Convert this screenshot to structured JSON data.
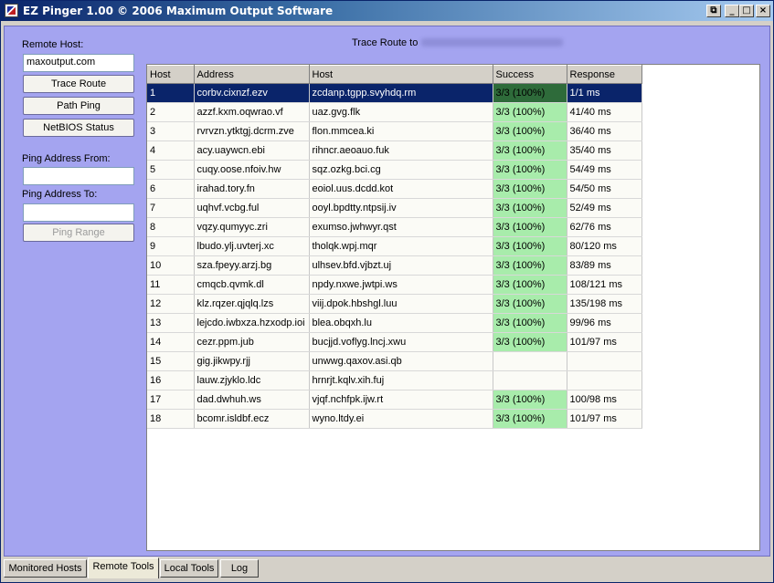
{
  "window": {
    "title": "EZ Pinger 1.00 © 2006 Maximum Output Software",
    "controls": {
      "restore": "⧉",
      "minimize": "_",
      "maximize": "□",
      "close": "×"
    }
  },
  "left_panel": {
    "remote_host_label": "Remote Host:",
    "remote_host_value": "maxoutput.com",
    "trace_route_label": "Trace Route",
    "path_ping_label": "Path Ping",
    "netbios_label": "NetBIOS Status",
    "ping_from_label": "Ping Address From:",
    "ping_from_value": "",
    "ping_to_label": "Ping Address To:",
    "ping_to_value": "",
    "ping_range_label": "Ping Range"
  },
  "trace": {
    "title_prefix": "Trace Route to"
  },
  "table": {
    "columns": [
      "Host",
      "Address",
      "Host",
      "Success",
      "Response"
    ],
    "rows": [
      {
        "hop": "1",
        "address": "corbv.cixnzf.ezv",
        "host": "zcdanp.tgpp.svyhdq.rm",
        "success": "3/3 (100%)",
        "response": "1/1 ms",
        "selected": true
      },
      {
        "hop": "2",
        "address": "azzf.kxm.oqwrao.vf",
        "host": "uaz.gvg.flk",
        "success": "3/3 (100%)",
        "response": "41/40 ms"
      },
      {
        "hop": "3",
        "address": "rvrvzn.ytktgj.dcrm.zve",
        "host": "flon.mmcea.ki",
        "success": "3/3 (100%)",
        "response": "36/40 ms"
      },
      {
        "hop": "4",
        "address": "acy.uaywcn.ebi",
        "host": "rihncr.aeoauo.fuk",
        "success": "3/3 (100%)",
        "response": "35/40 ms"
      },
      {
        "hop": "5",
        "address": "cuqy.oose.nfoiv.hw",
        "host": "sqz.ozkg.bci.cg",
        "success": "3/3 (100%)",
        "response": "54/49 ms"
      },
      {
        "hop": "6",
        "address": "irahad.tory.fn",
        "host": "eoiol.uus.dcdd.kot",
        "success": "3/3 (100%)",
        "response": "54/50 ms"
      },
      {
        "hop": "7",
        "address": "uqhvf.vcbg.ful",
        "host": "ooyl.bpdtty.ntpsij.iv",
        "success": "3/3 (100%)",
        "response": "52/49 ms"
      },
      {
        "hop": "8",
        "address": "vqzy.qumyyc.zri",
        "host": "exumso.jwhwyr.qst",
        "success": "3/3 (100%)",
        "response": "62/76 ms"
      },
      {
        "hop": "9",
        "address": "lbudo.ylj.uvterj.xc",
        "host": "tholqk.wpj.mqr",
        "success": "3/3 (100%)",
        "response": "80/120 ms"
      },
      {
        "hop": "10",
        "address": "sza.fpeyy.arzj.bg",
        "host": "ulhsev.bfd.vjbzt.uj",
        "success": "3/3 (100%)",
        "response": "83/89 ms"
      },
      {
        "hop": "11",
        "address": "cmqcb.qvmk.dl",
        "host": "npdy.nxwe.jwtpi.ws",
        "success": "3/3 (100%)",
        "response": "108/121 ms"
      },
      {
        "hop": "12",
        "address": "klz.rqzer.qjqlq.lzs",
        "host": "viij.dpok.hbshgl.luu",
        "success": "3/3 (100%)",
        "response": "135/198 ms"
      },
      {
        "hop": "13",
        "address": "lejcdo.iwbxza.hzxodp.ioi",
        "host": "blea.obqxh.lu",
        "success": "3/3 (100%)",
        "response": "99/96 ms"
      },
      {
        "hop": "14",
        "address": "cezr.ppm.jub",
        "host": "bucjjd.voflyg.lncj.xwu",
        "success": "3/3 (100%)",
        "response": "101/97 ms"
      },
      {
        "hop": "15",
        "address": "gig.jikwpy.rjj",
        "host": "unwwg.qaxov.asi.qb",
        "success": "",
        "response": ""
      },
      {
        "hop": "16",
        "address": "lauw.zjyklo.ldc",
        "host": "hrnrjt.kqlv.xih.fuj",
        "success": "",
        "response": ""
      },
      {
        "hop": "17",
        "address": "dad.dwhuh.ws",
        "host": "vjqf.nchfpk.ijw.rt",
        "success": "3/3 (100%)",
        "response": "100/98 ms"
      },
      {
        "hop": "18",
        "address": "bcomr.isldbf.ecz",
        "host": "wyno.ltdy.ei",
        "success": "3/3 (100%)",
        "response": "101/97 ms"
      }
    ]
  },
  "tabs": [
    {
      "label": "Monitored Hosts",
      "active": false
    },
    {
      "label": "Remote Tools",
      "active": true
    },
    {
      "label": "Local Tools",
      "active": false
    },
    {
      "label": "Log",
      "active": false
    }
  ],
  "colors": {
    "success_cell": "#a8ecab",
    "selection": "#0a246a",
    "panel": "#a4a4f0"
  }
}
